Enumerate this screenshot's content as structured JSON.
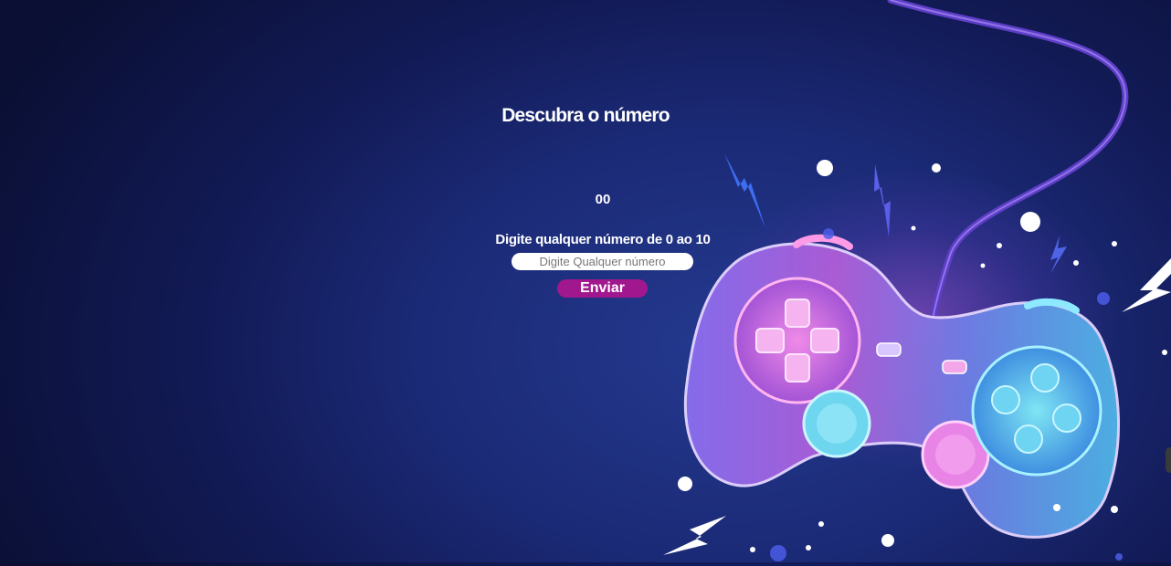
{
  "game": {
    "title": "Descubra o número",
    "display_value": "00",
    "instruction": "Digite qualquer número de 0 ao 10",
    "input_placeholder": "Digite Qualquer número",
    "submit_label": "Enviar"
  },
  "colors": {
    "background": "#1b2a76",
    "button": "#a1178e",
    "text": "#ffffff"
  }
}
